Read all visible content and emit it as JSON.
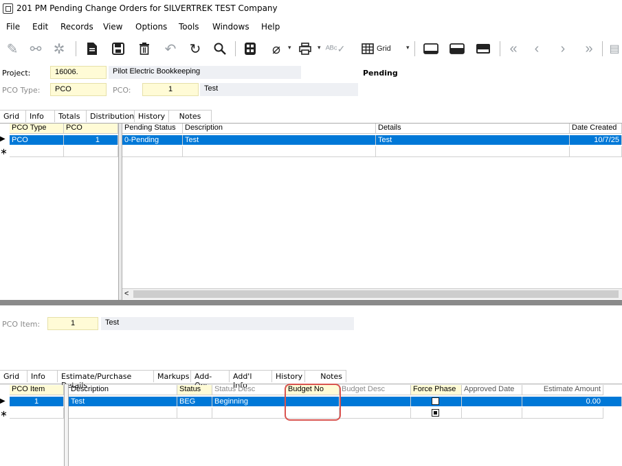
{
  "window": {
    "title": "201 PM Pending Change Orders for SILVERTREK TEST Company"
  },
  "menu": [
    "File",
    "Edit",
    "Records",
    "View",
    "Options",
    "Tools",
    "Windows",
    "Help"
  ],
  "toolbar": {
    "grid_label": "Grid",
    "icons": [
      "edit-icon",
      "binoculars-icon",
      "gear-icon",
      "new-document-icon",
      "save-icon",
      "delete-icon",
      "undo-icon",
      "refresh-icon",
      "search-icon",
      "calculator-icon",
      "attach-icon",
      "print-icon",
      "spellcheck-icon",
      "grid-icon",
      "layout-bottom-icon",
      "layout-split-icon",
      "layout-top-icon",
      "first-record-icon",
      "previous-record-icon",
      "next-record-icon",
      "last-record-icon"
    ]
  },
  "header": {
    "project_label": "Project:",
    "project_value": "16006.",
    "project_desc": "Pilot Electric Bookkeeping",
    "status": "Pending",
    "pco_type_label": "PCO Type:",
    "pco_type_value": "PCO",
    "pco_label": "PCO:",
    "pco_value": "1",
    "pco_desc": "Test"
  },
  "top_tabs": [
    "Grid",
    "Info",
    "Totals",
    "Distribution",
    "History",
    "Notes"
  ],
  "top_grid": {
    "columns": [
      "PCO Type",
      "PCO",
      "Pending Status",
      "Description",
      "Details",
      "Date Created"
    ],
    "rows": [
      [
        "PCO",
        "1",
        "0-Pending",
        "Test",
        "Test",
        "10/7/25"
      ]
    ],
    "scroll_left": "<"
  },
  "item_header": {
    "item_label": "PCO Item:",
    "item_value": "1",
    "item_desc": "Test"
  },
  "bottom_tabs": [
    "Grid",
    "Info",
    "Estimate/Purchase Details",
    "Markups",
    "Add-Ons",
    "Add'l Info",
    "History",
    "Notes"
  ],
  "bottom_grid": {
    "columns": [
      "PCO Item",
      "Description",
      "Status",
      "Status Desc",
      "Budget No",
      "Budget Desc",
      "Force Phase",
      "Approved Date",
      "Estimate Amount"
    ],
    "rows": [
      [
        "1",
        "Test",
        "BEG",
        "Beginning",
        "",
        "",
        "",
        "",
        "0.00"
      ]
    ],
    "force_phase_row1": false,
    "force_phase_new_row": true
  },
  "colors": {
    "selection": "#0078d7",
    "key_field": "#fffbd6",
    "highlight_box": "#d9534f"
  }
}
